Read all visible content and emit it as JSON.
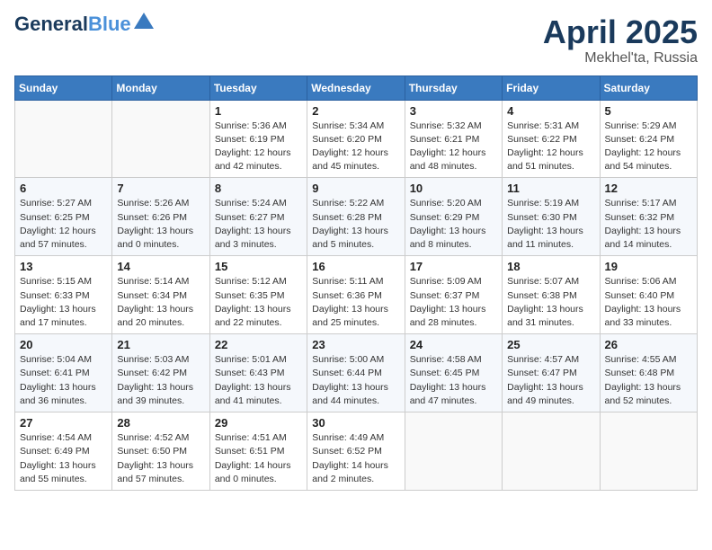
{
  "header": {
    "logo_line1": "General",
    "logo_line2": "Blue",
    "month": "April 2025",
    "location": "Mekhel'ta, Russia"
  },
  "weekdays": [
    "Sunday",
    "Monday",
    "Tuesday",
    "Wednesday",
    "Thursday",
    "Friday",
    "Saturday"
  ],
  "weeks": [
    [
      {
        "day": "",
        "info": ""
      },
      {
        "day": "",
        "info": ""
      },
      {
        "day": "1",
        "info": "Sunrise: 5:36 AM\nSunset: 6:19 PM\nDaylight: 12 hours\nand 42 minutes."
      },
      {
        "day": "2",
        "info": "Sunrise: 5:34 AM\nSunset: 6:20 PM\nDaylight: 12 hours\nand 45 minutes."
      },
      {
        "day": "3",
        "info": "Sunrise: 5:32 AM\nSunset: 6:21 PM\nDaylight: 12 hours\nand 48 minutes."
      },
      {
        "day": "4",
        "info": "Sunrise: 5:31 AM\nSunset: 6:22 PM\nDaylight: 12 hours\nand 51 minutes."
      },
      {
        "day": "5",
        "info": "Sunrise: 5:29 AM\nSunset: 6:24 PM\nDaylight: 12 hours\nand 54 minutes."
      }
    ],
    [
      {
        "day": "6",
        "info": "Sunrise: 5:27 AM\nSunset: 6:25 PM\nDaylight: 12 hours\nand 57 minutes."
      },
      {
        "day": "7",
        "info": "Sunrise: 5:26 AM\nSunset: 6:26 PM\nDaylight: 13 hours\nand 0 minutes."
      },
      {
        "day": "8",
        "info": "Sunrise: 5:24 AM\nSunset: 6:27 PM\nDaylight: 13 hours\nand 3 minutes."
      },
      {
        "day": "9",
        "info": "Sunrise: 5:22 AM\nSunset: 6:28 PM\nDaylight: 13 hours\nand 5 minutes."
      },
      {
        "day": "10",
        "info": "Sunrise: 5:20 AM\nSunset: 6:29 PM\nDaylight: 13 hours\nand 8 minutes."
      },
      {
        "day": "11",
        "info": "Sunrise: 5:19 AM\nSunset: 6:30 PM\nDaylight: 13 hours\nand 11 minutes."
      },
      {
        "day": "12",
        "info": "Sunrise: 5:17 AM\nSunset: 6:32 PM\nDaylight: 13 hours\nand 14 minutes."
      }
    ],
    [
      {
        "day": "13",
        "info": "Sunrise: 5:15 AM\nSunset: 6:33 PM\nDaylight: 13 hours\nand 17 minutes."
      },
      {
        "day": "14",
        "info": "Sunrise: 5:14 AM\nSunset: 6:34 PM\nDaylight: 13 hours\nand 20 minutes."
      },
      {
        "day": "15",
        "info": "Sunrise: 5:12 AM\nSunset: 6:35 PM\nDaylight: 13 hours\nand 22 minutes."
      },
      {
        "day": "16",
        "info": "Sunrise: 5:11 AM\nSunset: 6:36 PM\nDaylight: 13 hours\nand 25 minutes."
      },
      {
        "day": "17",
        "info": "Sunrise: 5:09 AM\nSunset: 6:37 PM\nDaylight: 13 hours\nand 28 minutes."
      },
      {
        "day": "18",
        "info": "Sunrise: 5:07 AM\nSunset: 6:38 PM\nDaylight: 13 hours\nand 31 minutes."
      },
      {
        "day": "19",
        "info": "Sunrise: 5:06 AM\nSunset: 6:40 PM\nDaylight: 13 hours\nand 33 minutes."
      }
    ],
    [
      {
        "day": "20",
        "info": "Sunrise: 5:04 AM\nSunset: 6:41 PM\nDaylight: 13 hours\nand 36 minutes."
      },
      {
        "day": "21",
        "info": "Sunrise: 5:03 AM\nSunset: 6:42 PM\nDaylight: 13 hours\nand 39 minutes."
      },
      {
        "day": "22",
        "info": "Sunrise: 5:01 AM\nSunset: 6:43 PM\nDaylight: 13 hours\nand 41 minutes."
      },
      {
        "day": "23",
        "info": "Sunrise: 5:00 AM\nSunset: 6:44 PM\nDaylight: 13 hours\nand 44 minutes."
      },
      {
        "day": "24",
        "info": "Sunrise: 4:58 AM\nSunset: 6:45 PM\nDaylight: 13 hours\nand 47 minutes."
      },
      {
        "day": "25",
        "info": "Sunrise: 4:57 AM\nSunset: 6:47 PM\nDaylight: 13 hours\nand 49 minutes."
      },
      {
        "day": "26",
        "info": "Sunrise: 4:55 AM\nSunset: 6:48 PM\nDaylight: 13 hours\nand 52 minutes."
      }
    ],
    [
      {
        "day": "27",
        "info": "Sunrise: 4:54 AM\nSunset: 6:49 PM\nDaylight: 13 hours\nand 55 minutes."
      },
      {
        "day": "28",
        "info": "Sunrise: 4:52 AM\nSunset: 6:50 PM\nDaylight: 13 hours\nand 57 minutes."
      },
      {
        "day": "29",
        "info": "Sunrise: 4:51 AM\nSunset: 6:51 PM\nDaylight: 14 hours\nand 0 minutes."
      },
      {
        "day": "30",
        "info": "Sunrise: 4:49 AM\nSunset: 6:52 PM\nDaylight: 14 hours\nand 2 minutes."
      },
      {
        "day": "",
        "info": ""
      },
      {
        "day": "",
        "info": ""
      },
      {
        "day": "",
        "info": ""
      }
    ]
  ]
}
